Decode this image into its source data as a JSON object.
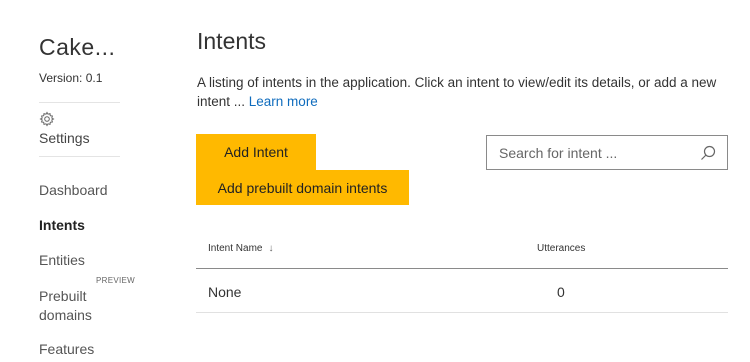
{
  "app": {
    "name": "Cake...",
    "version_label": "Version:",
    "version_value": "0.1"
  },
  "sidebar": {
    "settings_label": "Settings",
    "items": [
      {
        "label": "Dashboard",
        "active": false
      },
      {
        "label": "Intents",
        "active": true
      },
      {
        "label": "Entities",
        "active": false
      },
      {
        "label": "Prebuilt domains",
        "active": false,
        "badge": "PREVIEW"
      },
      {
        "label": "Features",
        "active": false
      }
    ]
  },
  "main": {
    "title": "Intents",
    "description": "A listing of intents in the application. Click an intent to view/edit its details, or add a new intent ... ",
    "learn_more": "Learn more",
    "add_intent_label": "Add Intent",
    "add_prebuilt_label": "Add prebuilt domain intents",
    "search": {
      "placeholder": "Search for intent ...",
      "value": ""
    },
    "table": {
      "columns": [
        "Intent Name",
        "Utterances"
      ],
      "sort_indicator": "↓",
      "rows": [
        {
          "name": "None",
          "utterances": "0"
        }
      ]
    }
  },
  "colors": {
    "accent_button": "#ffb900",
    "link": "#0f6cbd"
  },
  "icons": {
    "settings": "gear-icon",
    "search": "search-icon",
    "sort": "arrow-down-icon"
  }
}
